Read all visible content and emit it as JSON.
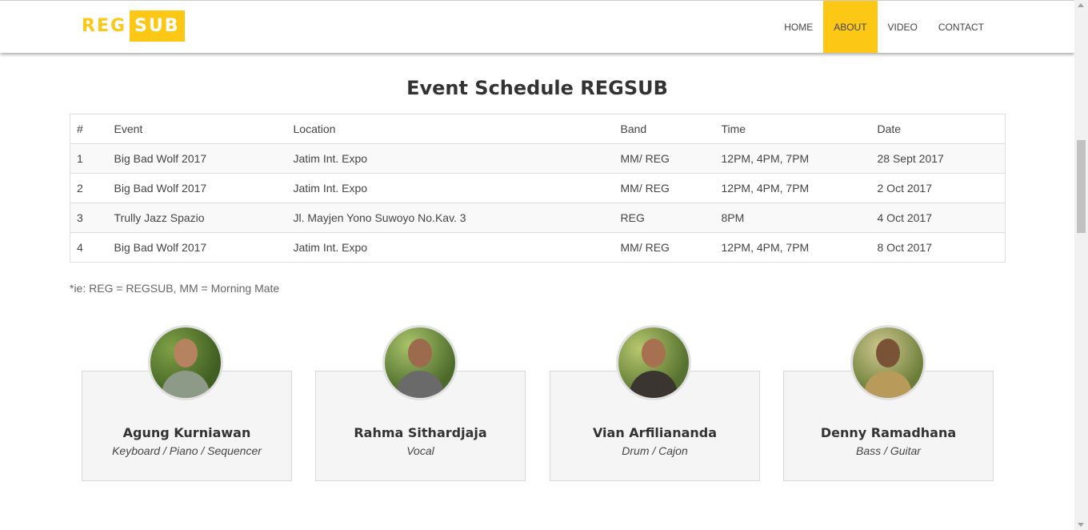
{
  "brand": {
    "part1": "REG",
    "part2": "SUB",
    "accent": "#fdc716"
  },
  "nav": [
    {
      "label": "HOME",
      "active": false
    },
    {
      "label": "ABOUT",
      "active": true
    },
    {
      "label": "VIDEO",
      "active": false
    },
    {
      "label": "CONTACT",
      "active": false
    }
  ],
  "schedule": {
    "title": "Event Schedule REGSUB",
    "headers": [
      "#",
      "Event",
      "Location",
      "Band",
      "Time",
      "Date"
    ],
    "rows": [
      [
        "1",
        "Big Bad Wolf 2017",
        "Jatim Int. Expo",
        "MM/ REG",
        "12PM, 4PM, 7PM",
        "28 Sept 2017"
      ],
      [
        "2",
        "Big Bad Wolf 2017",
        "Jatim Int. Expo",
        "MM/ REG",
        "12PM, 4PM, 7PM",
        "2 Oct 2017"
      ],
      [
        "3",
        "Trully Jazz Spazio",
        "Jl. Mayjen Yono Suwoyo No.Kav. 3",
        "REG",
        "8PM",
        "4 Oct 2017"
      ],
      [
        "4",
        "Big Bad Wolf 2017",
        "Jatim Int. Expo",
        "MM/ REG",
        "12PM, 4PM, 7PM",
        "8 Oct 2017"
      ]
    ],
    "note": "*ie:  REG = REGSUB, MM = Morning Mate"
  },
  "members": [
    {
      "name": "Agung Kurniawan",
      "role": "Keyboard / Piano / Sequencer"
    },
    {
      "name": "Rahma Sithardjaja",
      "role": "Vocal"
    },
    {
      "name": "Vian Arfiliananda",
      "role": "Drum / Cajon"
    },
    {
      "name": "Denny Ramadhana",
      "role": "Bass / Guitar"
    }
  ]
}
